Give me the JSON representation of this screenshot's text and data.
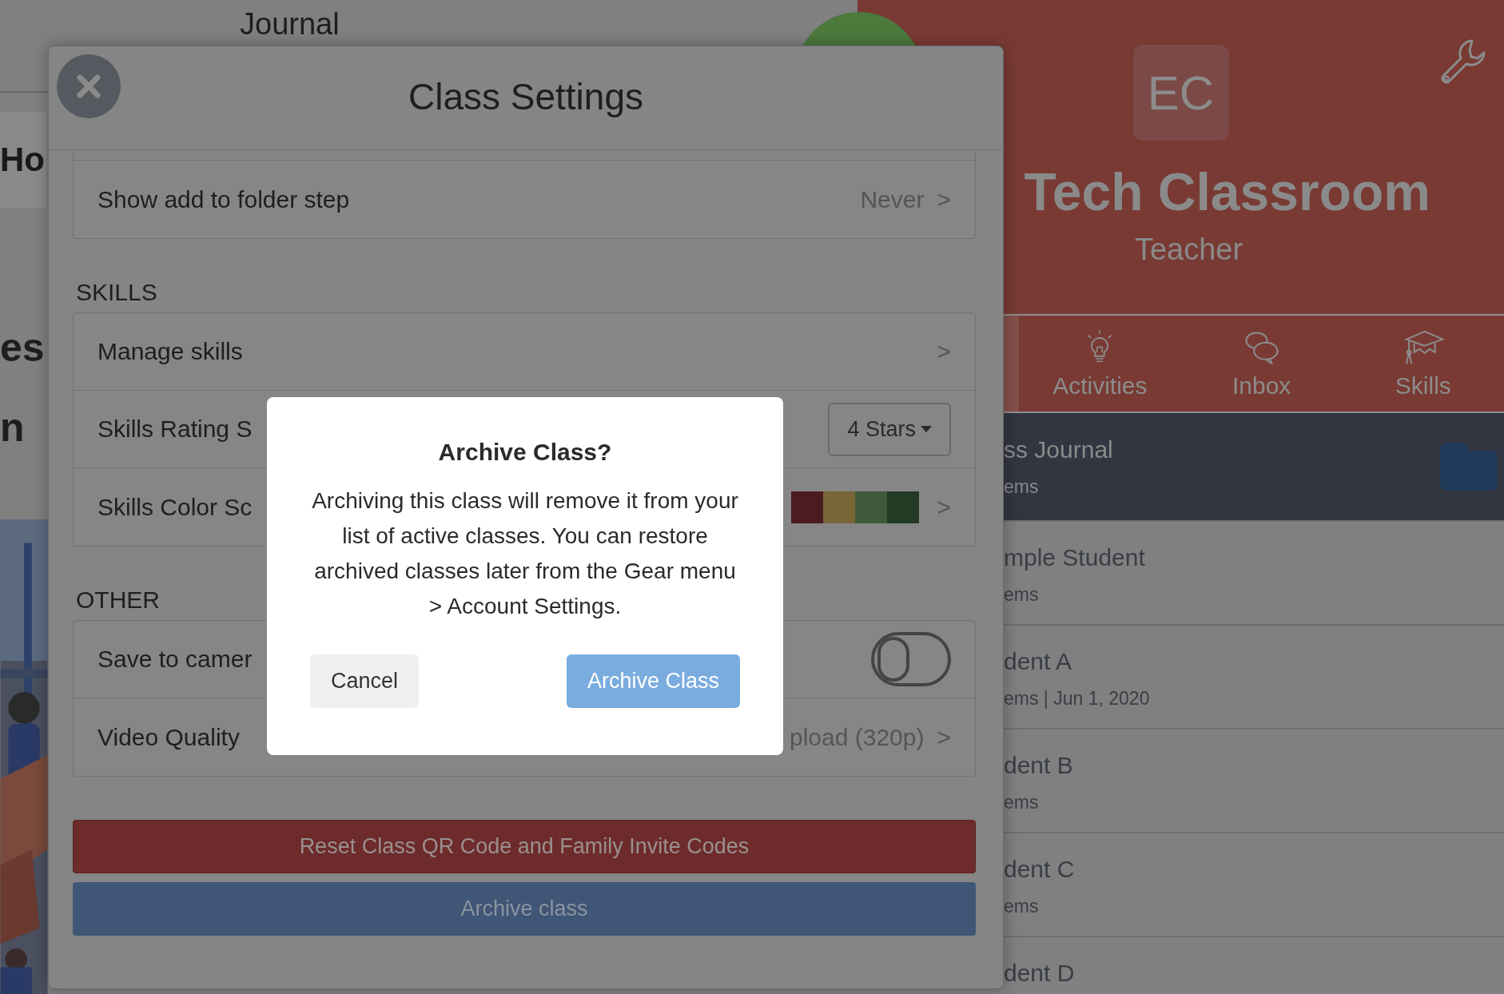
{
  "background_page": {
    "header_text": "Journal",
    "heading_fragment": "Ho",
    "title_fragments": [
      "es",
      "n"
    ],
    "photo": {
      "kind": "picture"
    }
  },
  "class_panel": {
    "avatar": "EC",
    "title": "Tech Classroom",
    "role": "Teacher",
    "nav": [
      {
        "label": "Activities",
        "selected": false
      },
      {
        "label": "Inbox",
        "selected": false
      },
      {
        "label": "Skills",
        "selected": false
      }
    ],
    "list": [
      {
        "name": "ss Journal",
        "detail": "ems",
        "selected": true,
        "kind": "folder"
      },
      {
        "name": "mple Student",
        "detail": "ems",
        "selected": false,
        "kind": "student"
      },
      {
        "name": "dent A",
        "detail": "ems | Jun 1, 2020",
        "selected": false,
        "kind": "student"
      },
      {
        "name": "dent B",
        "detail": "ems",
        "selected": false,
        "kind": "student"
      },
      {
        "name": "dent C",
        "detail": "ems",
        "selected": false,
        "kind": "student"
      },
      {
        "name": "dent D",
        "selected": false,
        "kind": "student"
      }
    ]
  },
  "settings_modal": {
    "title": "Class Settings",
    "sections": [
      {
        "rows": [
          {
            "kind": "link",
            "label": "Show add to folder step",
            "value": "Never",
            "chevron": ">"
          }
        ]
      },
      {
        "heading": "SKILLS",
        "rows": [
          {
            "kind": "link",
            "label": "Manage skills",
            "chevron": ">"
          },
          {
            "kind": "dropdown",
            "label": "Skills Rating S",
            "value": "4 Stars"
          },
          {
            "kind": "colors",
            "label": "Skills Color Sc",
            "colors": [
              {
                "color": "#4a1c20"
              },
              {
                "color": "#7a6536"
              },
              {
                "color": "#3f5a3a"
              },
              {
                "color": "#233a24"
              }
            ],
            "chevron": ">"
          }
        ]
      },
      {
        "heading": "OTHER",
        "rows": [
          {
            "kind": "toggle",
            "label": "Save to camer",
            "on": false
          },
          {
            "kind": "link",
            "label": "Video Quality",
            "value": "pload (320p)",
            "chevron": ">"
          }
        ]
      }
    ],
    "buttons": [
      {
        "kind": "danger",
        "label": "Reset Class QR Code and Family Invite Codes"
      },
      {
        "kind": "primary",
        "label": "Archive class"
      }
    ]
  },
  "dialog": {
    "title": "Archive Class?",
    "message": "Archiving this class will remove it from your list of active classes. You can restore archived classes later from the Gear menu > Account Settings.",
    "buttons": [
      {
        "kind": "secondary",
        "label": "Cancel"
      },
      {
        "kind": "primary",
        "label": "Archive Class"
      }
    ]
  }
}
